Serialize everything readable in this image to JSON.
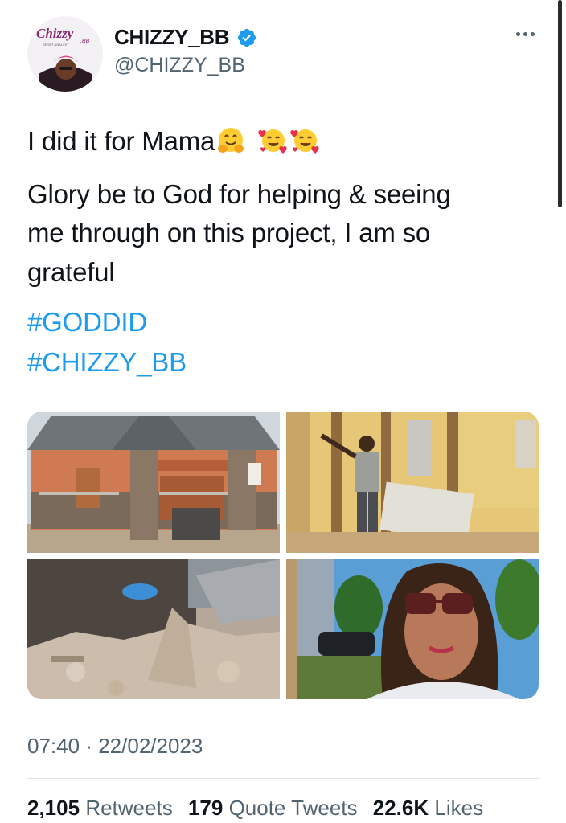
{
  "author": {
    "display_name": "CHIZZY_BB",
    "handle": "@CHIZZY_BB",
    "avatar_logo_text": "Chizzy",
    "avatar_logo_suffix": ".BB",
    "avatar_logo_subtext": "SPORT ANALYST",
    "verified": true
  },
  "tweet": {
    "line1": "I did it for Mama",
    "line1_emojis": [
      "hugging-face",
      "smiling-face-with-hearts",
      "smiling-face-with-hearts"
    ],
    "body_lines": [
      "Glory be to God for helping & seeing",
      "me through on this project, I am so",
      "grateful"
    ],
    "hashtags": [
      "#GODDID",
      "#CHIZZY_BB"
    ]
  },
  "media": [
    {
      "description_icon": "finished-bungalow-photo"
    },
    {
      "description_icon": "man-demolishing-wall-photo"
    },
    {
      "description_icon": "rubble-photo"
    },
    {
      "description_icon": "selfie-photo"
    }
  ],
  "meta": {
    "time": "07:40",
    "separator": "·",
    "date": "22/02/2023"
  },
  "stats": {
    "retweets_count": "2,105",
    "retweets_label": "Retweets",
    "quotes_count": "179",
    "quotes_label": "Quote Tweets",
    "likes_count": "22.6K",
    "likes_label": "Likes"
  },
  "colors": {
    "link": "#1d9bf0",
    "secondary_text": "#536471",
    "primary_text": "#0f1419",
    "verified_badge": "#1d9bf0"
  }
}
